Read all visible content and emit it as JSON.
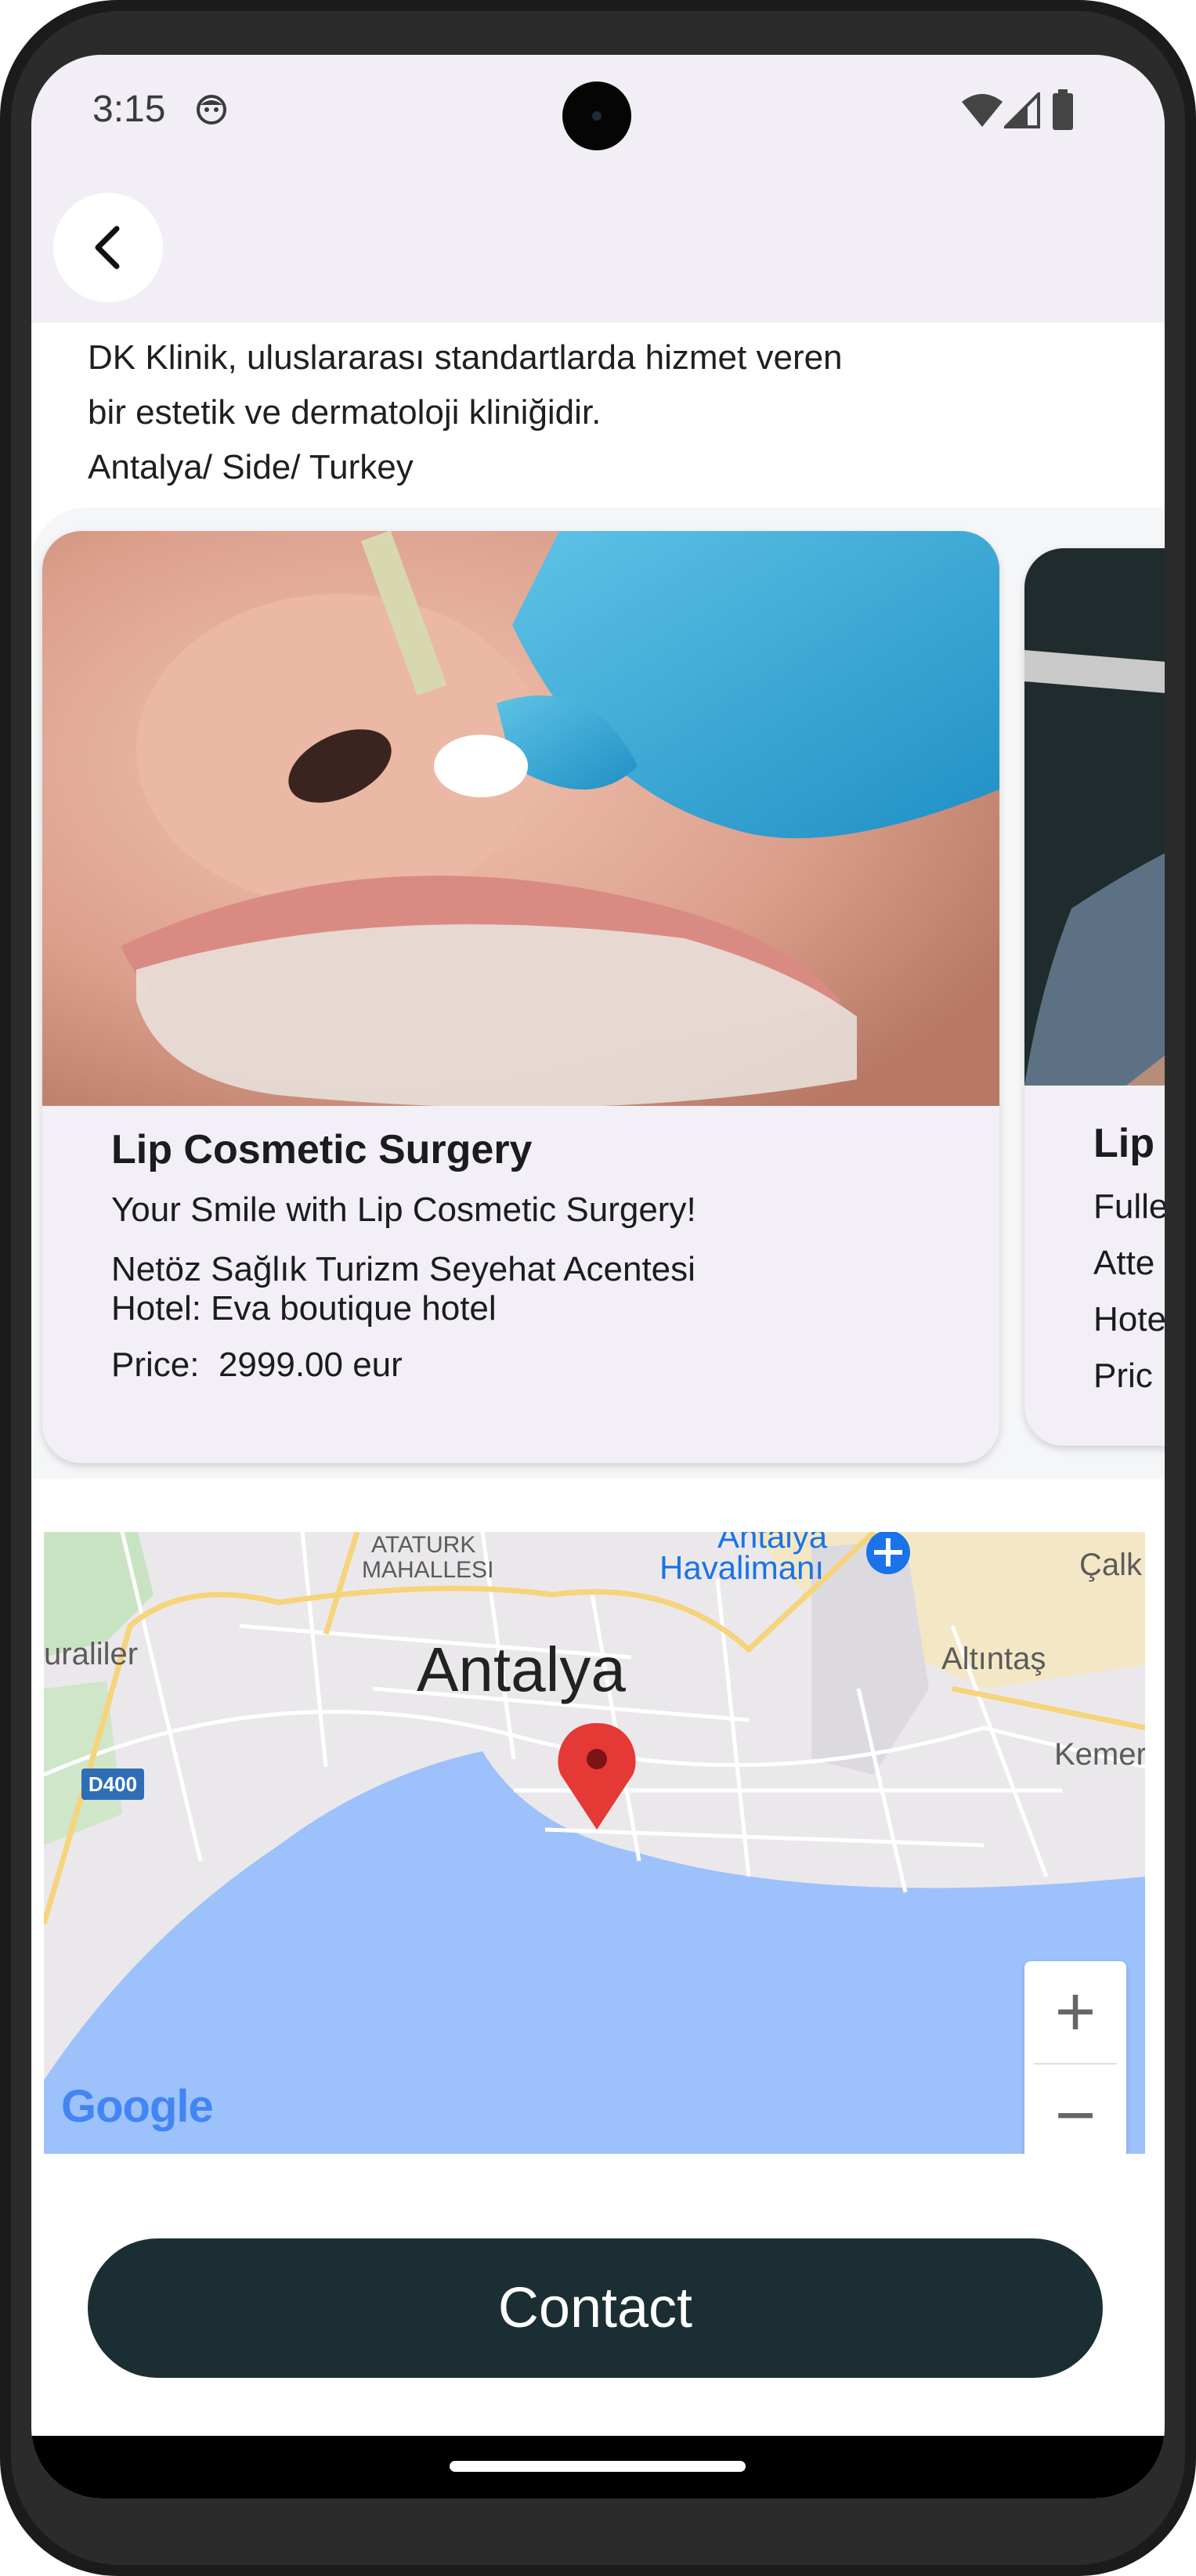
{
  "status_bar": {
    "time": "3:15"
  },
  "description": {
    "line1": "DK Klinik, uluslararası standartlarda hizmet veren",
    "line2": "bir estetik ve dermatoloji kliniğidir.",
    "line3": "Antalya/ Side/ Turkey"
  },
  "cards": [
    {
      "title": "Lip Cosmetic Surgery",
      "subtitle": "Your Smile with Lip Cosmetic Surgery!",
      "agency": "Netöz Sağlık Turizm Seyehat Acentesi",
      "hotel": "Hotel: Eva boutique hotel",
      "price_label": "Price:",
      "price_value": "2999.00 eur"
    },
    {
      "title": "Lip",
      "line1": "Fulle",
      "line2": "Atte",
      "line3": "Hote",
      "line4": "Pric"
    }
  ],
  "map": {
    "labels": {
      "neighborhood1": "ATATURK",
      "neighborhood2": "MAHALLESI",
      "airport1": "Antalya",
      "airport2": "Havalimanı",
      "city": "Antalya",
      "east1": "Çalk",
      "east2": "Altıntaş",
      "east3": "Kemer",
      "west1": "uraliler",
      "road": "D400"
    },
    "google": "Google",
    "zoom_in": "+",
    "zoom_out": "−",
    "colors": {
      "sea": "#9dc1fa",
      "land": "#ebe8ec",
      "road": "#f6d47b",
      "park": "#c8e3c2",
      "pin": "#e53935"
    }
  },
  "contact": {
    "label": "Contact"
  },
  "colors": {
    "header_bg": "#f2eef5",
    "button_bg": "#1b2e33"
  }
}
